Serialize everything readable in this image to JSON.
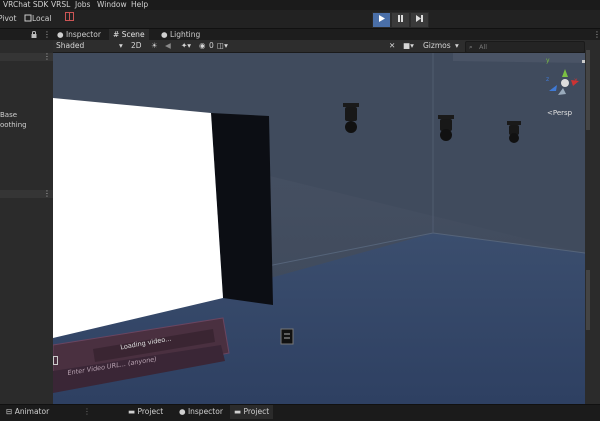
{
  "menu": [
    "VRChat SDK",
    "VRSL",
    "Jobs",
    "Window",
    "Help"
  ],
  "toolbar": {
    "pivot_label": "Pivot",
    "local_label": "Local",
    "play_icon": "play-icon",
    "pause_icon": "pause-icon",
    "step_icon": "step-icon"
  },
  "tabs": [
    {
      "label": "Inspector",
      "icon": "info-icon"
    },
    {
      "label": "Scene",
      "icon": "grid-icon"
    },
    {
      "label": "Lighting",
      "icon": "bulb-icon"
    }
  ],
  "scene_toolbar": {
    "shading_mode": "Shaded",
    "mode_2d": "2D",
    "gizmos_label": "Gizmos",
    "search_placeholder": "All",
    "overlay_count": "0"
  },
  "left_panel": {
    "line1": "Base",
    "line2": "oothing"
  },
  "scene": {
    "persp_label": "Persp",
    "gizmo_axes": {
      "x": "x",
      "y": "y",
      "z": "z"
    },
    "video_player": {
      "loading_text": "Loading video...",
      "url_placeholder": "Enter Video URL... (anyone)"
    }
  },
  "bottom_tabs": [
    {
      "label": "Animator",
      "icon": "animator-icon"
    },
    {
      "label": "Project",
      "icon": "folder-icon"
    },
    {
      "label": "Inspector",
      "icon": "info-icon"
    },
    {
      "label": "Project",
      "icon": "folder-icon"
    }
  ],
  "colors": {
    "accent": "#4a6fa8",
    "scene_wall": "#3f4a5c",
    "scene_floor": "#34445e"
  }
}
